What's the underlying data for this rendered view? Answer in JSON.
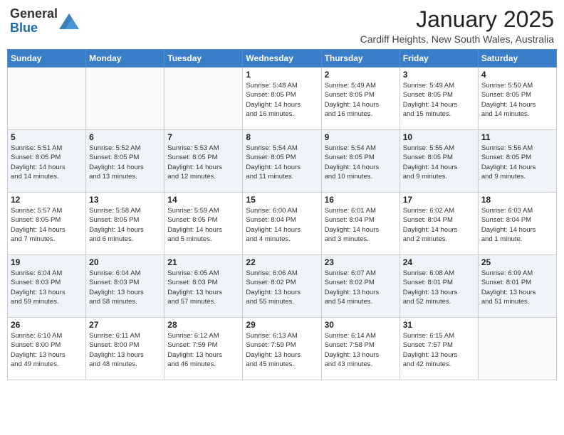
{
  "header": {
    "logo_general": "General",
    "logo_blue": "Blue",
    "month_title": "January 2025",
    "subtitle": "Cardiff Heights, New South Wales, Australia"
  },
  "weekdays": [
    "Sunday",
    "Monday",
    "Tuesday",
    "Wednesday",
    "Thursday",
    "Friday",
    "Saturday"
  ],
  "weeks": [
    [
      {
        "day": "",
        "detail": ""
      },
      {
        "day": "",
        "detail": ""
      },
      {
        "day": "",
        "detail": ""
      },
      {
        "day": "1",
        "detail": "Sunrise: 5:48 AM\nSunset: 8:05 PM\nDaylight: 14 hours\nand 16 minutes."
      },
      {
        "day": "2",
        "detail": "Sunrise: 5:49 AM\nSunset: 8:05 PM\nDaylight: 14 hours\nand 16 minutes."
      },
      {
        "day": "3",
        "detail": "Sunrise: 5:49 AM\nSunset: 8:05 PM\nDaylight: 14 hours\nand 15 minutes."
      },
      {
        "day": "4",
        "detail": "Sunrise: 5:50 AM\nSunset: 8:05 PM\nDaylight: 14 hours\nand 14 minutes."
      }
    ],
    [
      {
        "day": "5",
        "detail": "Sunrise: 5:51 AM\nSunset: 8:05 PM\nDaylight: 14 hours\nand 14 minutes."
      },
      {
        "day": "6",
        "detail": "Sunrise: 5:52 AM\nSunset: 8:05 PM\nDaylight: 14 hours\nand 13 minutes."
      },
      {
        "day": "7",
        "detail": "Sunrise: 5:53 AM\nSunset: 8:05 PM\nDaylight: 14 hours\nand 12 minutes."
      },
      {
        "day": "8",
        "detail": "Sunrise: 5:54 AM\nSunset: 8:05 PM\nDaylight: 14 hours\nand 11 minutes."
      },
      {
        "day": "9",
        "detail": "Sunrise: 5:54 AM\nSunset: 8:05 PM\nDaylight: 14 hours\nand 10 minutes."
      },
      {
        "day": "10",
        "detail": "Sunrise: 5:55 AM\nSunset: 8:05 PM\nDaylight: 14 hours\nand 9 minutes."
      },
      {
        "day": "11",
        "detail": "Sunrise: 5:56 AM\nSunset: 8:05 PM\nDaylight: 14 hours\nand 9 minutes."
      }
    ],
    [
      {
        "day": "12",
        "detail": "Sunrise: 5:57 AM\nSunset: 8:05 PM\nDaylight: 14 hours\nand 7 minutes."
      },
      {
        "day": "13",
        "detail": "Sunrise: 5:58 AM\nSunset: 8:05 PM\nDaylight: 14 hours\nand 6 minutes."
      },
      {
        "day": "14",
        "detail": "Sunrise: 5:59 AM\nSunset: 8:05 PM\nDaylight: 14 hours\nand 5 minutes."
      },
      {
        "day": "15",
        "detail": "Sunrise: 6:00 AM\nSunset: 8:04 PM\nDaylight: 14 hours\nand 4 minutes."
      },
      {
        "day": "16",
        "detail": "Sunrise: 6:01 AM\nSunset: 8:04 PM\nDaylight: 14 hours\nand 3 minutes."
      },
      {
        "day": "17",
        "detail": "Sunrise: 6:02 AM\nSunset: 8:04 PM\nDaylight: 14 hours\nand 2 minutes."
      },
      {
        "day": "18",
        "detail": "Sunrise: 6:03 AM\nSunset: 8:04 PM\nDaylight: 14 hours\nand 1 minute."
      }
    ],
    [
      {
        "day": "19",
        "detail": "Sunrise: 6:04 AM\nSunset: 8:03 PM\nDaylight: 13 hours\nand 59 minutes."
      },
      {
        "day": "20",
        "detail": "Sunrise: 6:04 AM\nSunset: 8:03 PM\nDaylight: 13 hours\nand 58 minutes."
      },
      {
        "day": "21",
        "detail": "Sunrise: 6:05 AM\nSunset: 8:03 PM\nDaylight: 13 hours\nand 57 minutes."
      },
      {
        "day": "22",
        "detail": "Sunrise: 6:06 AM\nSunset: 8:02 PM\nDaylight: 13 hours\nand 55 minutes."
      },
      {
        "day": "23",
        "detail": "Sunrise: 6:07 AM\nSunset: 8:02 PM\nDaylight: 13 hours\nand 54 minutes."
      },
      {
        "day": "24",
        "detail": "Sunrise: 6:08 AM\nSunset: 8:01 PM\nDaylight: 13 hours\nand 52 minutes."
      },
      {
        "day": "25",
        "detail": "Sunrise: 6:09 AM\nSunset: 8:01 PM\nDaylight: 13 hours\nand 51 minutes."
      }
    ],
    [
      {
        "day": "26",
        "detail": "Sunrise: 6:10 AM\nSunset: 8:00 PM\nDaylight: 13 hours\nand 49 minutes."
      },
      {
        "day": "27",
        "detail": "Sunrise: 6:11 AM\nSunset: 8:00 PM\nDaylight: 13 hours\nand 48 minutes."
      },
      {
        "day": "28",
        "detail": "Sunrise: 6:12 AM\nSunset: 7:59 PM\nDaylight: 13 hours\nand 46 minutes."
      },
      {
        "day": "29",
        "detail": "Sunrise: 6:13 AM\nSunset: 7:59 PM\nDaylight: 13 hours\nand 45 minutes."
      },
      {
        "day": "30",
        "detail": "Sunrise: 6:14 AM\nSunset: 7:58 PM\nDaylight: 13 hours\nand 43 minutes."
      },
      {
        "day": "31",
        "detail": "Sunrise: 6:15 AM\nSunset: 7:57 PM\nDaylight: 13 hours\nand 42 minutes."
      },
      {
        "day": "",
        "detail": ""
      }
    ]
  ]
}
